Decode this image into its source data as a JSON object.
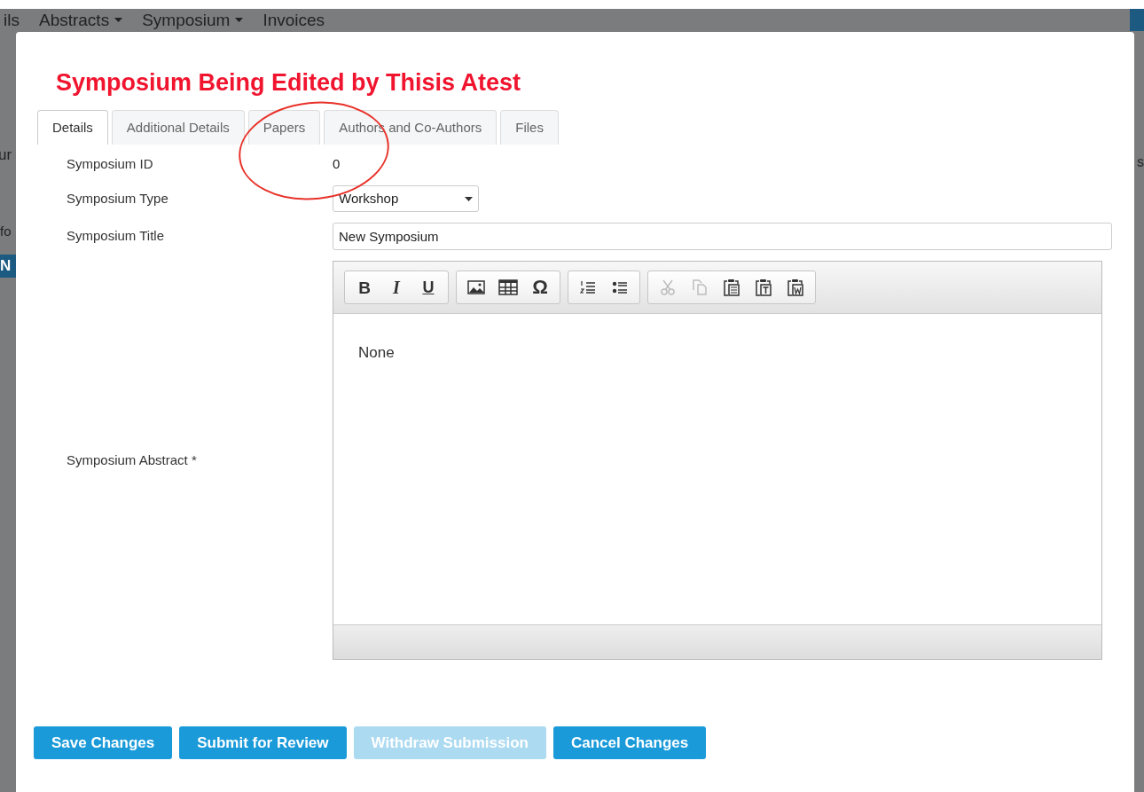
{
  "background": {
    "nav_items": [
      {
        "label": "ils",
        "dropdown": false
      },
      {
        "label": "Abstracts",
        "dropdown": true
      },
      {
        "label": "Symposium",
        "dropdown": true
      },
      {
        "label": "Invoices",
        "dropdown": false
      }
    ],
    "left_fragments": [
      "ur",
      "fo",
      "N"
    ],
    "right_fragment": "S"
  },
  "dialog": {
    "title": "Symposium Being Edited by Thisis Atest",
    "tabs": [
      {
        "label": "Details",
        "selected": true
      },
      {
        "label": "Additional Details",
        "selected": false
      },
      {
        "label": "Papers",
        "selected": false
      },
      {
        "label": "Authors and Co-Authors",
        "selected": false
      },
      {
        "label": "Files",
        "selected": false
      }
    ],
    "fields": [
      {
        "kind": "text",
        "label": "Symposium ID",
        "value": "0"
      },
      {
        "kind": "select",
        "label": "Symposium Type",
        "value": "Workshop"
      },
      {
        "kind": "input",
        "label": "Symposium Title",
        "value": "New Symposium"
      },
      {
        "kind": "editor",
        "label": "Symposium Abstract",
        "required_mark": "*",
        "value": "None"
      }
    ],
    "toolbar_groups": [
      [
        {
          "kind": "bold",
          "label": "B",
          "disabled": false
        },
        {
          "kind": "italic",
          "label": "I",
          "disabled": false
        },
        {
          "kind": "underline",
          "label": "U",
          "disabled": false
        }
      ],
      [
        {
          "kind": "image",
          "disabled": false
        },
        {
          "kind": "table",
          "disabled": false
        },
        {
          "kind": "char",
          "label": "Ω",
          "disabled": false
        }
      ],
      [
        {
          "kind": "numbered",
          "disabled": false
        },
        {
          "kind": "bulleted",
          "disabled": false
        }
      ],
      [
        {
          "kind": "cut",
          "disabled": true
        },
        {
          "kind": "copy",
          "disabled": true
        },
        {
          "kind": "paste",
          "disabled": false
        },
        {
          "kind": "paste-text",
          "disabled": false
        },
        {
          "kind": "paste-word",
          "disabled": false
        }
      ]
    ],
    "buttons": [
      {
        "label": "Save Changes",
        "disabled": false
      },
      {
        "label": "Submit for Review",
        "disabled": false
      },
      {
        "label": "Withdraw Submission",
        "disabled": true
      },
      {
        "label": "Cancel Changes",
        "disabled": false
      }
    ]
  }
}
